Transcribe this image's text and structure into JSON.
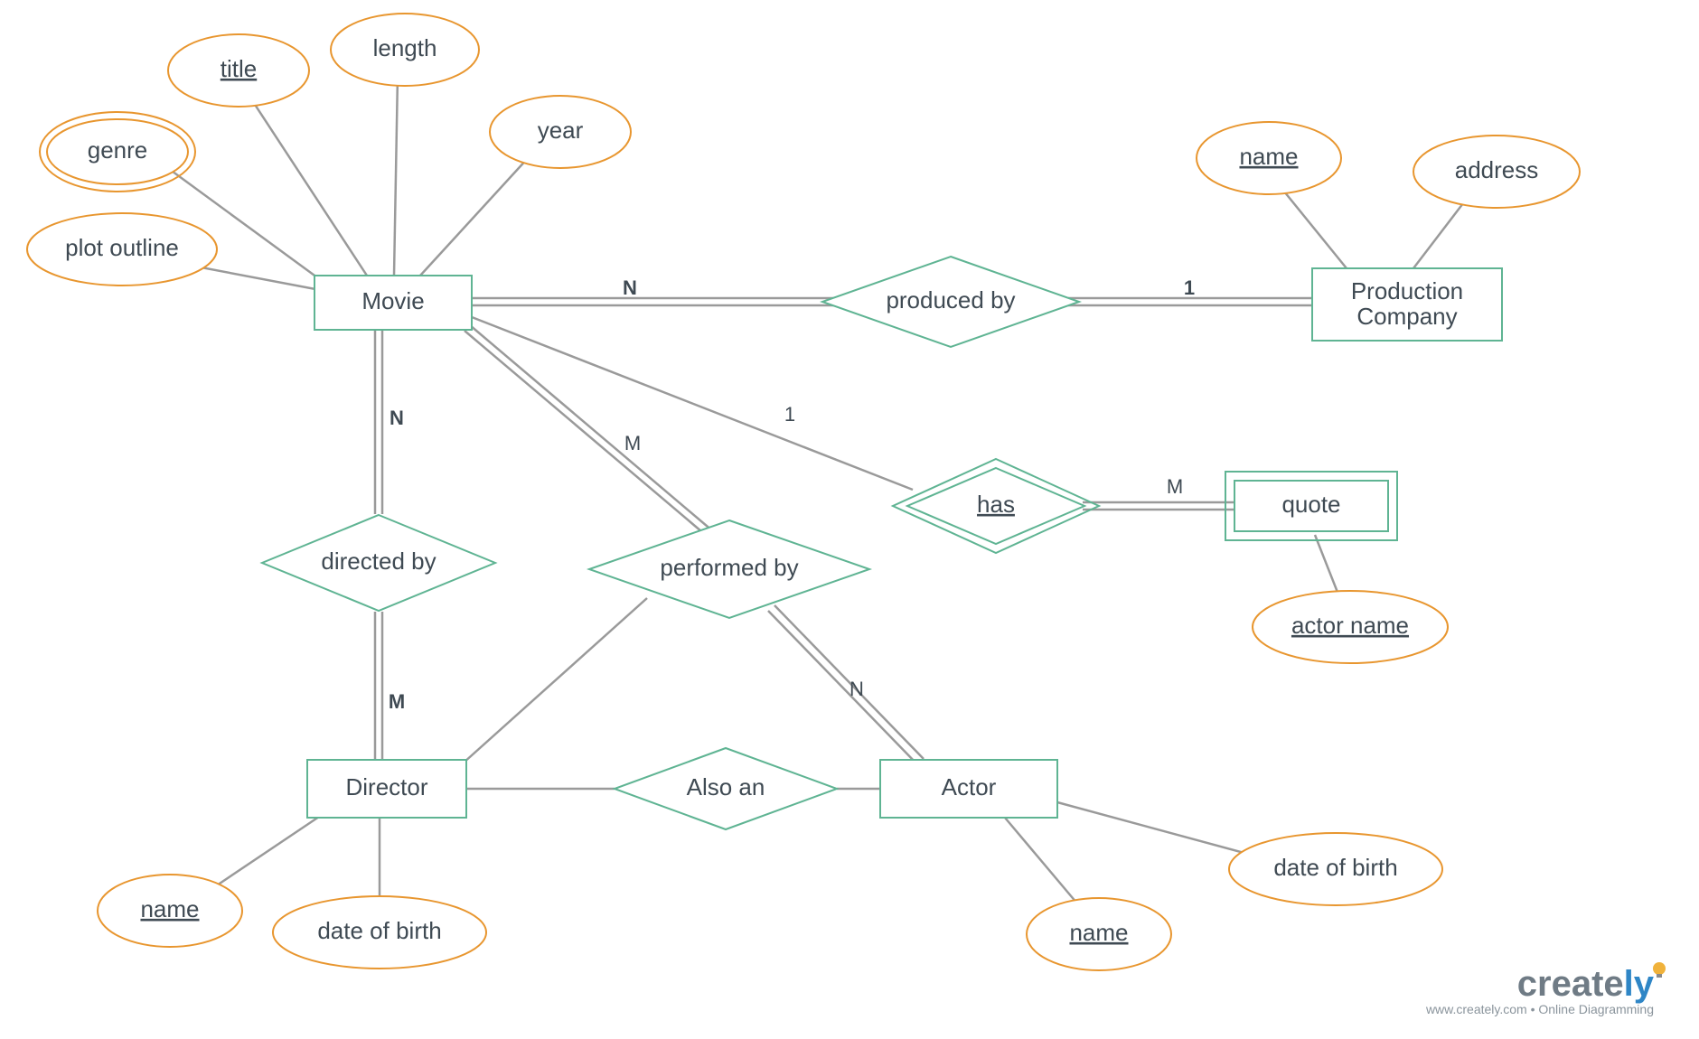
{
  "entities": {
    "movie": "Movie",
    "production_company_l1": "Production",
    "production_company_l2": "Company",
    "director": "Director",
    "actor": "Actor",
    "quote": "quote"
  },
  "attributes": {
    "title": "title",
    "length": "length",
    "year": "year",
    "genre": "genre",
    "plot_outline": "plot outline",
    "pc_name": "name",
    "pc_address": "address",
    "director_name": "name",
    "director_dob": "date of birth",
    "actor_name": "name",
    "actor_dob": "date of birth",
    "quote_actor_name": "actor name"
  },
  "relationships": {
    "produced_by": "produced by",
    "directed_by": "directed by",
    "performed_by": "performed by",
    "also_an": "Also an",
    "has": "has"
  },
  "cardinalities": {
    "movie_produced": "N",
    "pc_produced": "1",
    "movie_directed": "N",
    "director_directed": "M",
    "movie_performed": "M",
    "actor_performed": "N",
    "movie_has": "1",
    "quote_has": "M"
  },
  "branding": {
    "logo_main": "create",
    "logo_accent": "ly",
    "tagline": "www.creately.com • Online Diagramming"
  }
}
